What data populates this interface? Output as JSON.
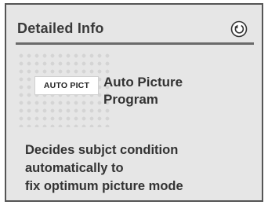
{
  "header": {
    "title": "Detailed Info",
    "back_icon": "back-arrow-circle-icon"
  },
  "mode": {
    "badge": "AUTO PICT",
    "name_line1": "Auto Picture",
    "name_line2": "Program"
  },
  "description": {
    "lines": [
      "Decides subjct condition",
      "automatically to",
      "fix optimum picture mode"
    ]
  }
}
